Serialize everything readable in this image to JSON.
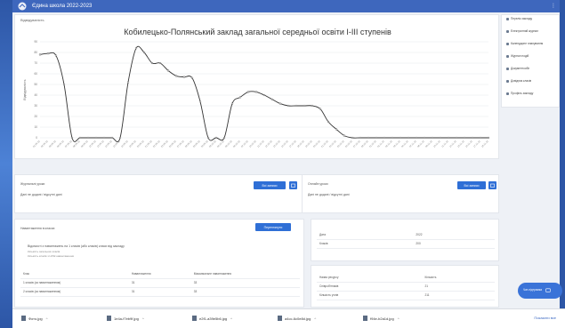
{
  "topbar": {
    "title": "Єдина школа 2022-2023"
  },
  "breadcrumb": "Відвідуваність",
  "chart_data": {
    "type": "line",
    "title": "Кобилецько-Полянський заклад загальної середньої освіти І-ІІІ ступенів",
    "ylabel": "Відвідуваність",
    "ylim": [
      0,
      90
    ],
    "yticks": [
      0,
      10,
      20,
      30,
      40,
      50,
      60,
      70,
      80,
      90
    ],
    "x": [
      "01.09.22",
      "02.09.22",
      "05.09.22",
      "06.09.22",
      "07.09.22",
      "08.09.22",
      "09.09.22",
      "12.09.22",
      "13.09.22",
      "14.09.22",
      "15.09.22",
      "16.09.22",
      "19.09.22",
      "20.09.22",
      "21.09.22",
      "22.09.22",
      "23.09.22",
      "26.09.22",
      "27.09.22",
      "28.09.22",
      "29.09.22",
      "30.09.22",
      "03.10.22",
      "04.10.22",
      "05.10.22",
      "06.10.22",
      "07.10.22",
      "10.10.22",
      "11.10.22",
      "12.10.22",
      "13.10.22",
      "14.10.22",
      "17.10.22",
      "18.10.22",
      "19.10.22",
      "20.10.22",
      "21.10.22",
      "24.10.22",
      "25.10.22",
      "26.10.22",
      "27.10.22",
      "28.10.22",
      "31.10.22",
      "01.11.22",
      "02.11.22",
      "03.11.22",
      "04.11.22",
      "07.11.22",
      "08.11.22",
      "09.11.22",
      "10.11.22",
      "11.11.22",
      "14.11.22",
      "15.11.22",
      "16.11.22",
      "17.11.22",
      "18.11.22"
    ],
    "series": [
      {
        "values": [
          78,
          79,
          77,
          50,
          0,
          0,
          0,
          0,
          0,
          0,
          0,
          52,
          84,
          80,
          70,
          70,
          63,
          58,
          57,
          56,
          34,
          0,
          0,
          0,
          32,
          38,
          43,
          43,
          40,
          36,
          32,
          30,
          30,
          30,
          30,
          27,
          15,
          8,
          2,
          0,
          0,
          0,
          0,
          0,
          0,
          0,
          0,
          0,
          0,
          0,
          0,
          0,
          0,
          0,
          0,
          0,
          0
        ]
      }
    ],
    "grid": true
  },
  "panel_left_top": {
    "title": "Журнальні уроки",
    "subtitle": "",
    "note": "Дані не додані / відсутні дані",
    "button": "Всі записи"
  },
  "panel_right_top": {
    "title": "Онлайн уроки",
    "subtitle": "",
    "note": "Дані не додані / відсутні дані",
    "button": "Всі записи"
  },
  "panel_left_bottom": {
    "title": "Навантаження в класах",
    "button": "Переглянути",
    "info": [
      "Відомості з навантажень на 1 класів (або класів) класи від закладу",
      "Кількість загальних класів",
      "Кількість класів з НУШ навантаження"
    ],
    "table": {
      "headers": [
        "Клас",
        "Навантаження",
        "Максимальне навантаження"
      ],
      "rows": [
        [
          "1 класів (за навантаженням)",
          "31",
          "33"
        ],
        [
          "2 класів (за навантаженням)",
          "31",
          "33"
        ]
      ]
    }
  },
  "panel_right_mid": {
    "rows": [
      [
        "Дата",
        "2022"
      ],
      [
        "Класів",
        "200"
      ]
    ]
  },
  "panel_right_bottom": {
    "headers": [
      "Назва ресурсу",
      "Кількість"
    ],
    "rows": [
      [
        "Співробітників",
        "21"
      ],
      [
        "Кількість учнів",
        "211"
      ]
    ]
  },
  "side_menu": [
    "Перелік закладу",
    "Електронний журнал",
    "Календарне планування",
    "Журнал подій",
    "Документообіг",
    "Довідник класів",
    "Профіль закладу"
  ],
  "helper": {
    "label": "Чат-підтримка"
  },
  "downloads": [
    {
      "name": "Фото.jpg"
    },
    {
      "name": "1e4a-f7eb9f.jpg"
    },
    {
      "name": "e2f1-a39e5b6.jpg"
    },
    {
      "name": "a4cc-6c0e8d.jpg"
    },
    {
      "name": "f94e-b2a1d.jpg"
    }
  ],
  "download_show_all": "Показати все",
  "colors": {
    "accent": "#3e67bd",
    "button": "#2f6fd6",
    "line": "#333333"
  }
}
